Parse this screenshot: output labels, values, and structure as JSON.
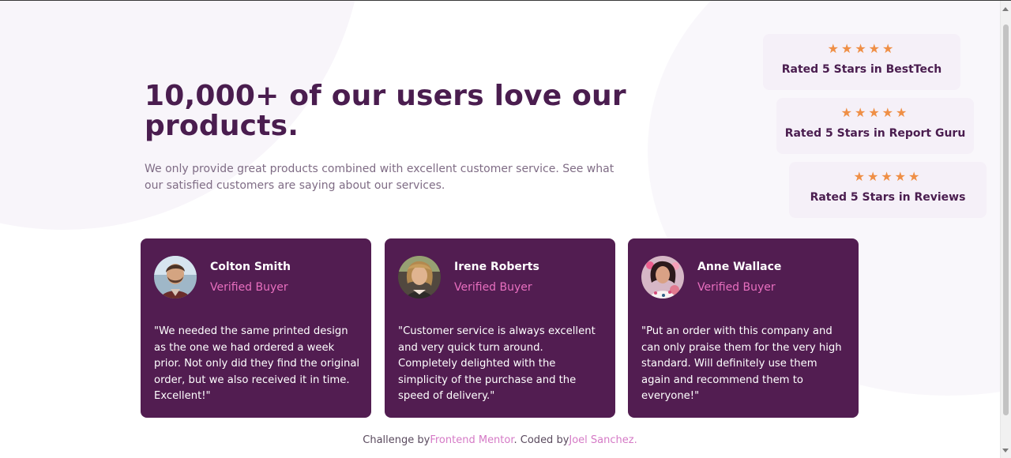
{
  "hero": {
    "title": "10,000+ of our users love our products.",
    "description": "We only provide great products combined with excellent customer service. See what our satisfied customers are saying about our services."
  },
  "ratings": [
    {
      "stars": "★★★★★",
      "label": "Rated 5 Stars in BestTech",
      "star_count": 5
    },
    {
      "stars": "★★★★★",
      "label": "Rated 5 Stars in Report Guru",
      "star_count": 5
    },
    {
      "stars": "★★★★★",
      "label": "Rated 5 Stars in Reviews",
      "star_count": 5
    }
  ],
  "testimonials": [
    {
      "name": "Colton Smith",
      "role": "Verified Buyer",
      "quote": "\"We needed the same printed design as the one we had ordered a week prior. Not only did they find the original order, but we also received it in time. Excellent!\""
    },
    {
      "name": "Irene Roberts",
      "role": "Verified Buyer",
      "quote": "\"Customer service is always excellent and very quick turn around. Completely delighted with the simplicity of the purchase and the speed of delivery.\""
    },
    {
      "name": "Anne Wallace",
      "role": "Verified Buyer",
      "quote": "\"Put an order with this company and can only praise them for the very high standard. Will definitely use them again and recommend them to everyone!\""
    }
  ],
  "footer": {
    "challenge_prefix": "Challenge by",
    "challenge_link": "Frontend Mentor",
    "separator": ". Coded by",
    "author_link": "Joel Sanchez",
    "suffix": "."
  },
  "colors": {
    "primary": "#4a1d4f",
    "card_background": "#521d51",
    "accent_pink": "#e86fbf",
    "star_orange": "#ef8f46",
    "rating_background": "#f5f0f8"
  },
  "icons": {
    "star": "star-icon",
    "avatar": "avatar"
  }
}
